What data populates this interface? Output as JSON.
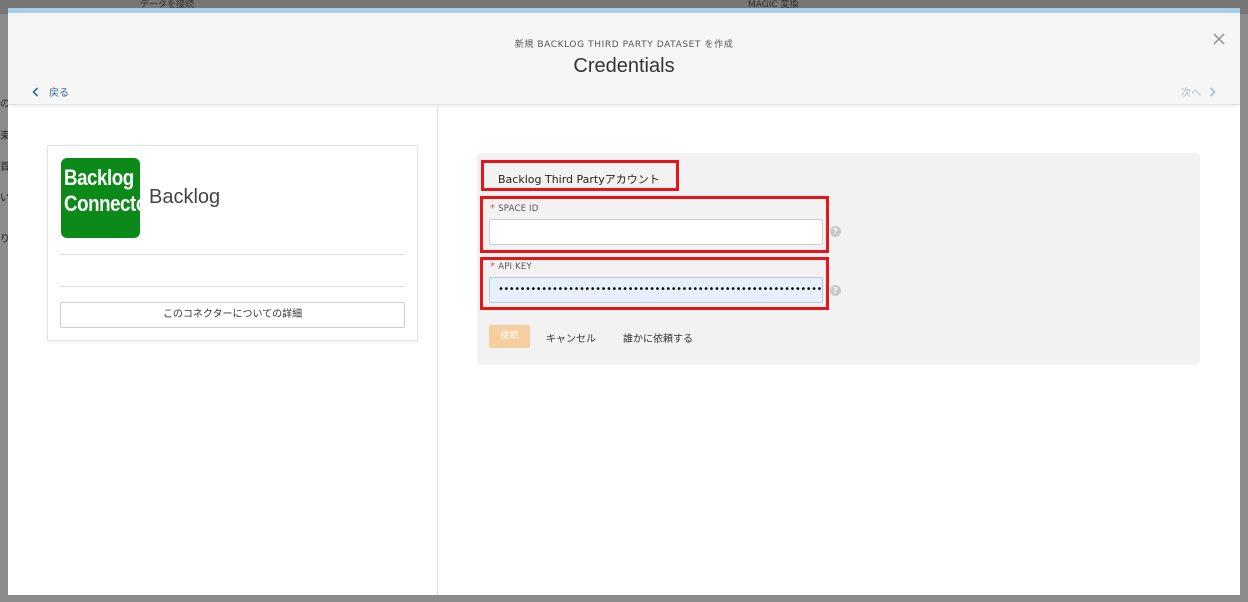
{
  "background": {
    "toolbar_items": [
      "データを接続",
      "MAGIC 変換"
    ],
    "left_fragments": [
      "の",
      "束",
      "首",
      "い",
      "り"
    ]
  },
  "modal": {
    "subtitle": "新規 BACKLOG THIRD PARTY DATASET を作成",
    "title": "Credentials",
    "back_label": "戻る",
    "next_label": "次へ",
    "close_icon": "close-icon"
  },
  "connector": {
    "logo_line1": "Backlog",
    "logo_line2": "Connector",
    "name": "Backlog",
    "detail_button": "このコネクターについての詳細",
    "logo_color": "#0b8a1a"
  },
  "form": {
    "account_label": "Backlog Third Partyアカウント",
    "space_id": {
      "label": "SPACE ID",
      "value": "",
      "required_mark": "*"
    },
    "api_key": {
      "label": "API KEY",
      "value": "••••••••••••••••••••••••••••••••••••••••••••••••••••••••••••••••••",
      "required_mark": "*"
    },
    "help_glyph": "?",
    "buttons": {
      "connect": "接続",
      "cancel": "キャンセル",
      "ask": "誰かに依頼する"
    },
    "highlight_color": "#e8141a",
    "connect_color": "#f6cfa0"
  }
}
